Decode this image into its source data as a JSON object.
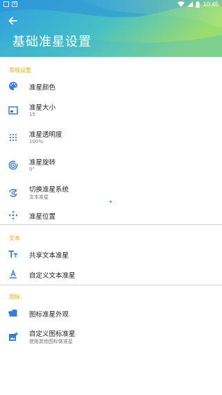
{
  "statusbar": {
    "time": "10:45"
  },
  "header": {
    "title": "基础准星设置"
  },
  "sections": {
    "general": {
      "title": "常规设置"
    },
    "text": {
      "title": "文本"
    },
    "icon": {
      "title": "图标"
    }
  },
  "items": {
    "color": {
      "label": "准星颜色"
    },
    "size": {
      "label": "准星大小",
      "value": "15"
    },
    "opacity": {
      "label": "准星透明度",
      "value": "100%"
    },
    "rotation": {
      "label": "准星旋转",
      "value": "0°"
    },
    "switch_system": {
      "label": "切换准星系统",
      "value": "文本准星"
    },
    "position": {
      "label": "准星位置"
    },
    "share_text": {
      "label": "共享文本准星"
    },
    "custom_text": {
      "label": "自定义文本准星"
    },
    "icon_appearance": {
      "label": "图标准星外观"
    },
    "custom_icon": {
      "label": "自定义图标准星",
      "value": "使用其他图标做准星"
    }
  },
  "colors": {
    "accent": "#3a7bd5",
    "section": "#f0a81c",
    "header_gradient": [
      "#2b9be0",
      "#52c9b0",
      "#a3dc6a"
    ]
  }
}
